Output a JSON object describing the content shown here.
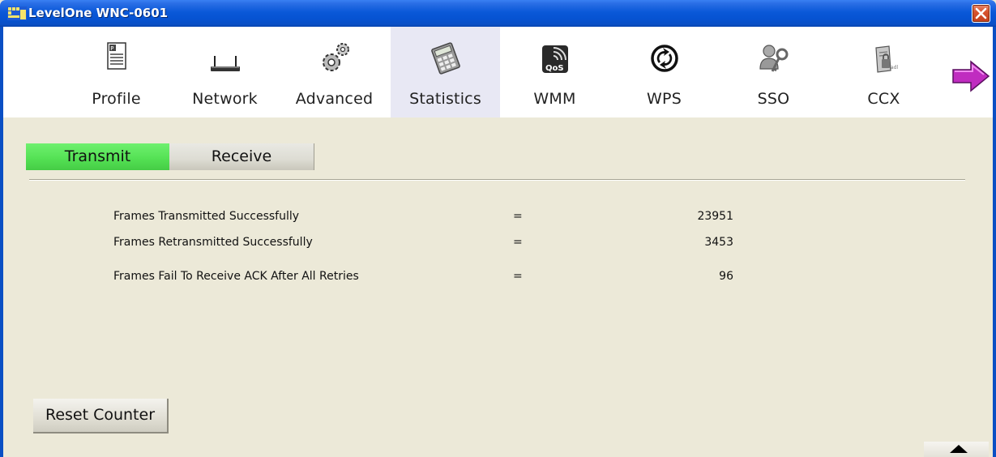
{
  "window": {
    "title": "LevelOne WNC-0601"
  },
  "toolbar": {
    "items": [
      {
        "label": "Profile",
        "icon": "profile-icon"
      },
      {
        "label": "Network",
        "icon": "router-icon"
      },
      {
        "label": "Advanced",
        "icon": "gears-icon"
      },
      {
        "label": "Statistics",
        "icon": "calculator-icon",
        "selected": true
      },
      {
        "label": "WMM",
        "icon": "qos-icon"
      },
      {
        "label": "WPS",
        "icon": "wps-icon"
      },
      {
        "label": "SSO",
        "icon": "user-key-icon"
      },
      {
        "label": "CCX",
        "icon": "ccx-icon"
      }
    ],
    "next_icon": "right-arrow-icon"
  },
  "tabs": {
    "transmit": "Transmit",
    "receive": "Receive",
    "active": "Transmit"
  },
  "stats": [
    {
      "label": "Frames Transmitted Successfully",
      "sep": "=",
      "value": "23951"
    },
    {
      "label": "Frames Retransmitted Successfully",
      "sep": "=",
      "value": "3453"
    },
    {
      "label": "Frames Fail To Receive ACK After All Retries",
      "sep": "=",
      "value": "96"
    }
  ],
  "buttons": {
    "reset": "Reset Counter"
  },
  "colors": {
    "titlebar": "#0a58d8",
    "active_tab": "#55e255",
    "window_bg": "#ece9d8",
    "next_arrow": "#c02cc0"
  }
}
